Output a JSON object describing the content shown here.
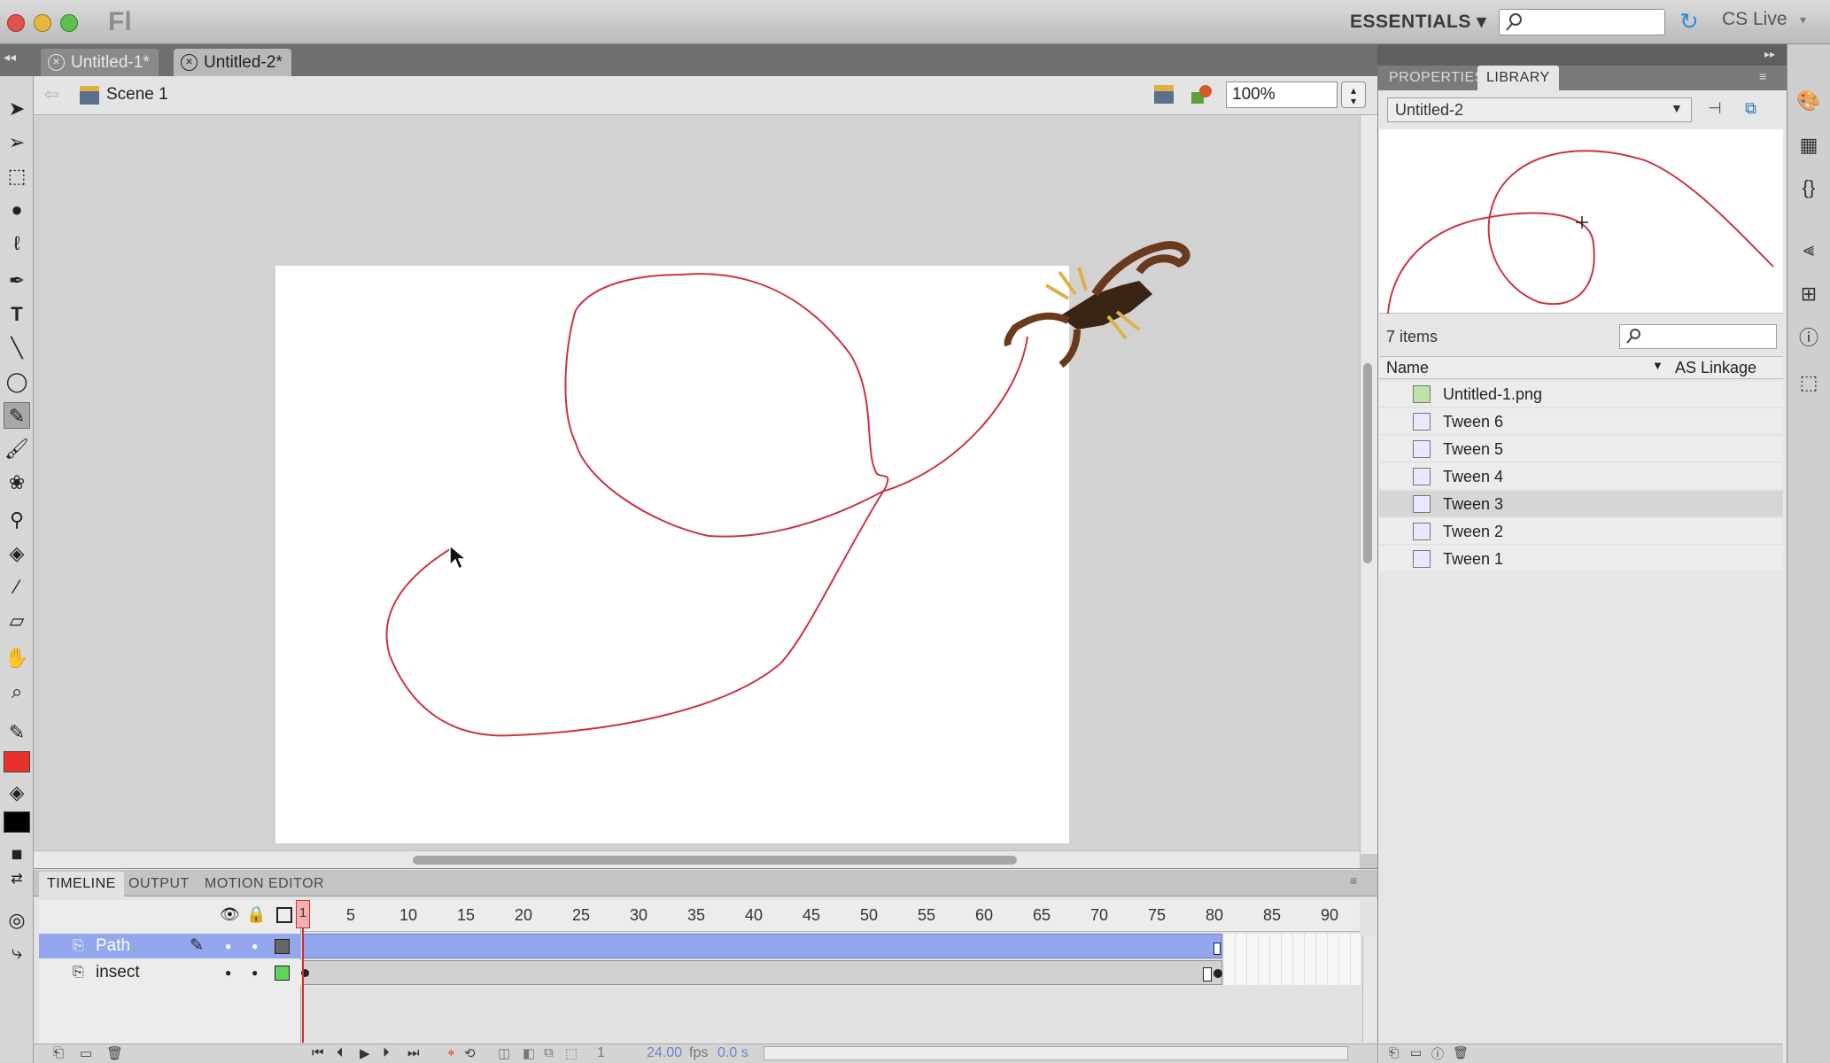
{
  "app": {
    "logo": "Fl"
  },
  "titlebar": {
    "workspace": "ESSENTIALS ▾",
    "search_placeholder": "",
    "cslive": "CS Live"
  },
  "colors": {
    "stroke": "#cc3344",
    "fill": "#000000",
    "selected_frames": "#93a8ec",
    "playhead": "#d42a2a"
  },
  "document_tabs": [
    {
      "label": "Untitled-1*"
    },
    {
      "label": "Untitled-2*"
    }
  ],
  "editbar": {
    "scene": "Scene 1",
    "zoom": "100%"
  },
  "timeline": {
    "tabs": [
      "TIMELINE",
      "OUTPUT",
      "MOTION EDITOR"
    ],
    "frame_numbers": [
      "1",
      "5",
      "10",
      "15",
      "20",
      "25",
      "30",
      "35",
      "40",
      "45",
      "50",
      "55",
      "60",
      "65",
      "70",
      "75",
      "80",
      "85",
      "90"
    ],
    "layers": [
      {
        "name": "Path",
        "selected": true
      },
      {
        "name": "insect",
        "selected": false
      }
    ],
    "current_frame": "1",
    "fps": "24.00",
    "fps_unit": "fps",
    "time": "0.0 s"
  },
  "panel": {
    "tabs": [
      "PROPERTIES",
      "LIBRARY"
    ],
    "active_tab": "LIBRARY",
    "library_select": "Untitled-2",
    "item_count": "7 items",
    "columns": {
      "name": "Name",
      "linkage": "AS Linkage"
    },
    "items": [
      {
        "name": "Untitled-1.png",
        "kind": "bitmap"
      },
      {
        "name": "Tween 6",
        "kind": "symbol"
      },
      {
        "name": "Tween 5",
        "kind": "symbol"
      },
      {
        "name": "Tween 4",
        "kind": "symbol"
      },
      {
        "name": "Tween 3",
        "kind": "symbol",
        "selected": true
      },
      {
        "name": "Tween 2",
        "kind": "symbol"
      },
      {
        "name": "Tween 1",
        "kind": "symbol"
      }
    ]
  }
}
